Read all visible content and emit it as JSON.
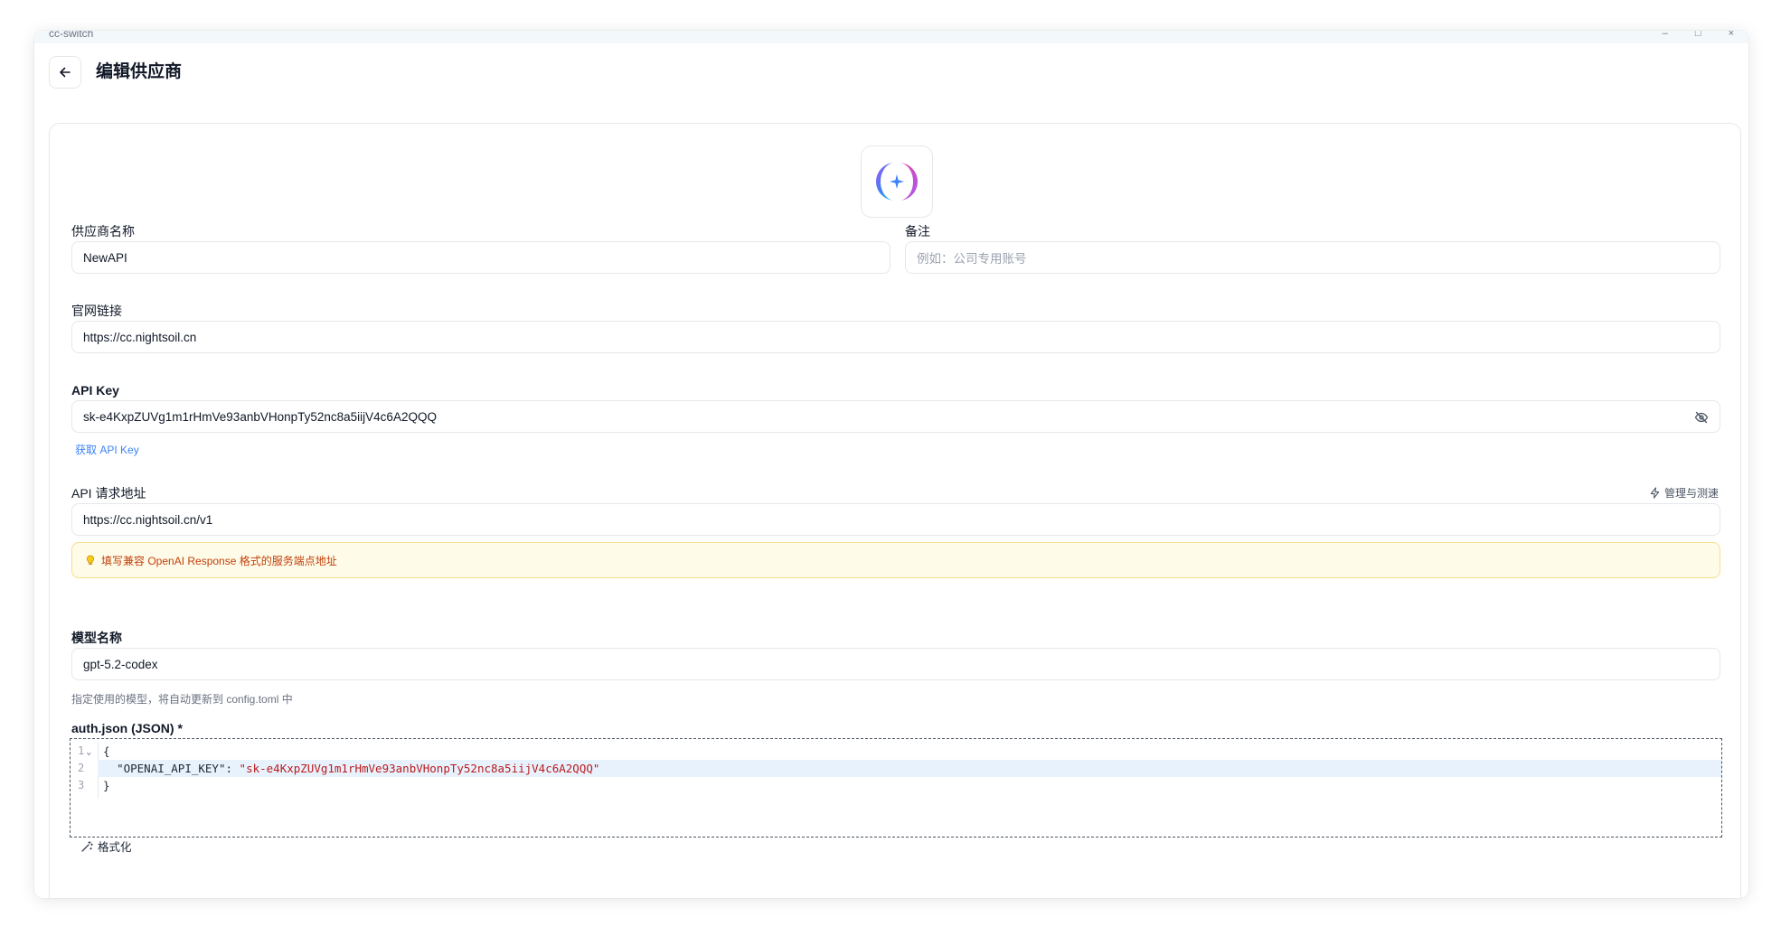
{
  "window": {
    "app_title": "cc-switch",
    "ctl_min": "–",
    "ctl_max": "□",
    "ctl_close": "×"
  },
  "header": {
    "title": "编辑供应商"
  },
  "form": {
    "provider_name": {
      "label": "供应商名称",
      "value": "NewAPI"
    },
    "notes": {
      "label": "备注",
      "placeholder": "例如：公司专用账号"
    },
    "website": {
      "label": "官网链接",
      "value": "https://cc.nightsoil.cn"
    },
    "api_key": {
      "label": "API Key",
      "value": "sk-e4KxpZUVg1m1rHmVe93anbVHonpTy52nc8a5iijV4c6A2QQQ",
      "get_link": "获取 API Key"
    },
    "endpoint": {
      "label": "API 请求地址",
      "manage_label": "管理与测速",
      "value": "https://cc.nightsoil.cn/v1",
      "notice": "填写兼容 OpenAI Response 格式的服务端点地址"
    },
    "model": {
      "label": "模型名称",
      "value": "gpt-5.2-codex",
      "hint": "指定使用的模型，将自动更新到 config.toml 中"
    },
    "auth_json": {
      "label": "auth.json (JSON) *",
      "lines": [
        {
          "num": "1",
          "code": "{"
        },
        {
          "num": "2",
          "key": "\"OPENAI_API_KEY\"",
          "colon": ": ",
          "str": "\"sk-e4KxpZUVg1m1rHmVe93anbVHonpTy52nc8a5iijV4c6A2QQQ\""
        },
        {
          "num": "3",
          "code": "}"
        }
      ],
      "format_label": "格式化"
    }
  },
  "colors": {
    "accent": "#3b82f6",
    "notice_bg": "#fefbe8",
    "notice_text": "#c2410c",
    "string_token": "#b91c1c"
  },
  "icons": {
    "back": "arrow-left-icon",
    "eye": "eye-off-icon",
    "manage": "bolt-icon",
    "notice": "lightbulb-icon",
    "format": "wand-icon",
    "logo": "provider-logo-icon"
  }
}
